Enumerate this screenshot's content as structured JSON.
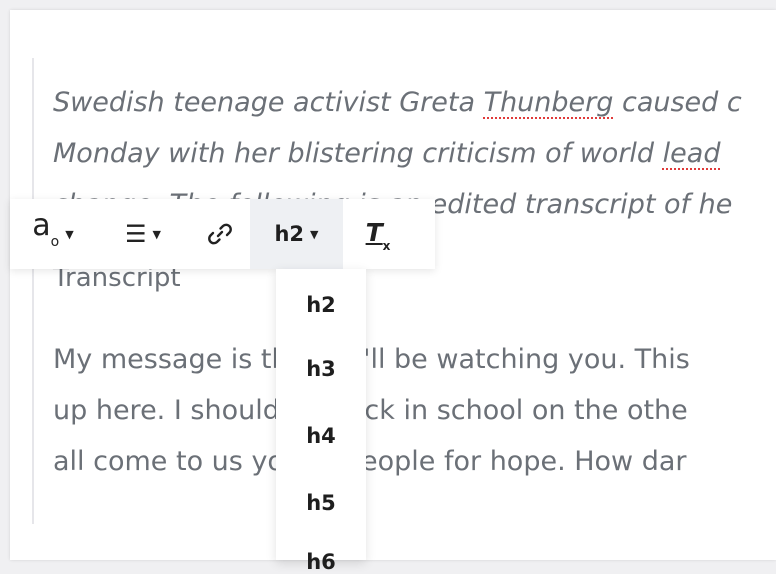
{
  "editor": {
    "intro_lines": {
      "l1_before": "Swedish teenage activist Greta ",
      "l1_misspelled": "Thunberg",
      "l1_after": " caused c",
      "l2_before": "Monday with her blistering criticism of world ",
      "l2_misspelled": "lead",
      "l3": "change. The following is an edited transcript of he"
    },
    "heading": "Transcript",
    "body_lines": [
      "My message is that we'll be watching you. This",
      "up here. I should be back in school on the othe",
      "all come to us young people for hope. How dar"
    ]
  },
  "toolbar": {
    "font_icon_main": "a",
    "font_icon_sub": "o",
    "list_icon": "☰",
    "caret": "▼",
    "heading_value": "h2",
    "clear_format_main": "T",
    "clear_format_sub": "x"
  },
  "heading_dropdown": {
    "options": [
      "h2",
      "h3",
      "h4",
      "h5",
      "h6"
    ]
  },
  "colors": {
    "text": "#6b7077",
    "spellcheck": "#e03a3a",
    "active_tool_bg": "#eef0f3"
  }
}
